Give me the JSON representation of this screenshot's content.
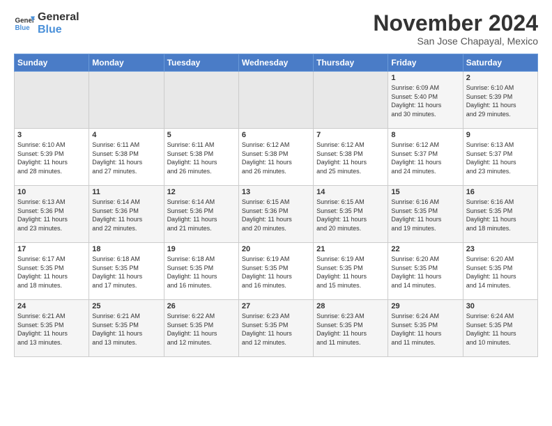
{
  "logo": {
    "line1": "General",
    "line2": "Blue"
  },
  "title": "November 2024",
  "location": "San Jose Chapayal, Mexico",
  "weekdays": [
    "Sunday",
    "Monday",
    "Tuesday",
    "Wednesday",
    "Thursday",
    "Friday",
    "Saturday"
  ],
  "weeks": [
    [
      {
        "day": "",
        "info": ""
      },
      {
        "day": "",
        "info": ""
      },
      {
        "day": "",
        "info": ""
      },
      {
        "day": "",
        "info": ""
      },
      {
        "day": "",
        "info": ""
      },
      {
        "day": "1",
        "info": "Sunrise: 6:09 AM\nSunset: 5:40 PM\nDaylight: 11 hours\nand 30 minutes."
      },
      {
        "day": "2",
        "info": "Sunrise: 6:10 AM\nSunset: 5:39 PM\nDaylight: 11 hours\nand 29 minutes."
      }
    ],
    [
      {
        "day": "3",
        "info": "Sunrise: 6:10 AM\nSunset: 5:39 PM\nDaylight: 11 hours\nand 28 minutes."
      },
      {
        "day": "4",
        "info": "Sunrise: 6:11 AM\nSunset: 5:38 PM\nDaylight: 11 hours\nand 27 minutes."
      },
      {
        "day": "5",
        "info": "Sunrise: 6:11 AM\nSunset: 5:38 PM\nDaylight: 11 hours\nand 26 minutes."
      },
      {
        "day": "6",
        "info": "Sunrise: 6:12 AM\nSunset: 5:38 PM\nDaylight: 11 hours\nand 26 minutes."
      },
      {
        "day": "7",
        "info": "Sunrise: 6:12 AM\nSunset: 5:38 PM\nDaylight: 11 hours\nand 25 minutes."
      },
      {
        "day": "8",
        "info": "Sunrise: 6:12 AM\nSunset: 5:37 PM\nDaylight: 11 hours\nand 24 minutes."
      },
      {
        "day": "9",
        "info": "Sunrise: 6:13 AM\nSunset: 5:37 PM\nDaylight: 11 hours\nand 23 minutes."
      }
    ],
    [
      {
        "day": "10",
        "info": "Sunrise: 6:13 AM\nSunset: 5:36 PM\nDaylight: 11 hours\nand 23 minutes."
      },
      {
        "day": "11",
        "info": "Sunrise: 6:14 AM\nSunset: 5:36 PM\nDaylight: 11 hours\nand 22 minutes."
      },
      {
        "day": "12",
        "info": "Sunrise: 6:14 AM\nSunset: 5:36 PM\nDaylight: 11 hours\nand 21 minutes."
      },
      {
        "day": "13",
        "info": "Sunrise: 6:15 AM\nSunset: 5:36 PM\nDaylight: 11 hours\nand 20 minutes."
      },
      {
        "day": "14",
        "info": "Sunrise: 6:15 AM\nSunset: 5:35 PM\nDaylight: 11 hours\nand 20 minutes."
      },
      {
        "day": "15",
        "info": "Sunrise: 6:16 AM\nSunset: 5:35 PM\nDaylight: 11 hours\nand 19 minutes."
      },
      {
        "day": "16",
        "info": "Sunrise: 6:16 AM\nSunset: 5:35 PM\nDaylight: 11 hours\nand 18 minutes."
      }
    ],
    [
      {
        "day": "17",
        "info": "Sunrise: 6:17 AM\nSunset: 5:35 PM\nDaylight: 11 hours\nand 18 minutes."
      },
      {
        "day": "18",
        "info": "Sunrise: 6:18 AM\nSunset: 5:35 PM\nDaylight: 11 hours\nand 17 minutes."
      },
      {
        "day": "19",
        "info": "Sunrise: 6:18 AM\nSunset: 5:35 PM\nDaylight: 11 hours\nand 16 minutes."
      },
      {
        "day": "20",
        "info": "Sunrise: 6:19 AM\nSunset: 5:35 PM\nDaylight: 11 hours\nand 16 minutes."
      },
      {
        "day": "21",
        "info": "Sunrise: 6:19 AM\nSunset: 5:35 PM\nDaylight: 11 hours\nand 15 minutes."
      },
      {
        "day": "22",
        "info": "Sunrise: 6:20 AM\nSunset: 5:35 PM\nDaylight: 11 hours\nand 14 minutes."
      },
      {
        "day": "23",
        "info": "Sunrise: 6:20 AM\nSunset: 5:35 PM\nDaylight: 11 hours\nand 14 minutes."
      }
    ],
    [
      {
        "day": "24",
        "info": "Sunrise: 6:21 AM\nSunset: 5:35 PM\nDaylight: 11 hours\nand 13 minutes."
      },
      {
        "day": "25",
        "info": "Sunrise: 6:21 AM\nSunset: 5:35 PM\nDaylight: 11 hours\nand 13 minutes."
      },
      {
        "day": "26",
        "info": "Sunrise: 6:22 AM\nSunset: 5:35 PM\nDaylight: 11 hours\nand 12 minutes."
      },
      {
        "day": "27",
        "info": "Sunrise: 6:23 AM\nSunset: 5:35 PM\nDaylight: 11 hours\nand 12 minutes."
      },
      {
        "day": "28",
        "info": "Sunrise: 6:23 AM\nSunset: 5:35 PM\nDaylight: 11 hours\nand 11 minutes."
      },
      {
        "day": "29",
        "info": "Sunrise: 6:24 AM\nSunset: 5:35 PM\nDaylight: 11 hours\nand 11 minutes."
      },
      {
        "day": "30",
        "info": "Sunrise: 6:24 AM\nSunset: 5:35 PM\nDaylight: 11 hours\nand 10 minutes."
      }
    ]
  ]
}
